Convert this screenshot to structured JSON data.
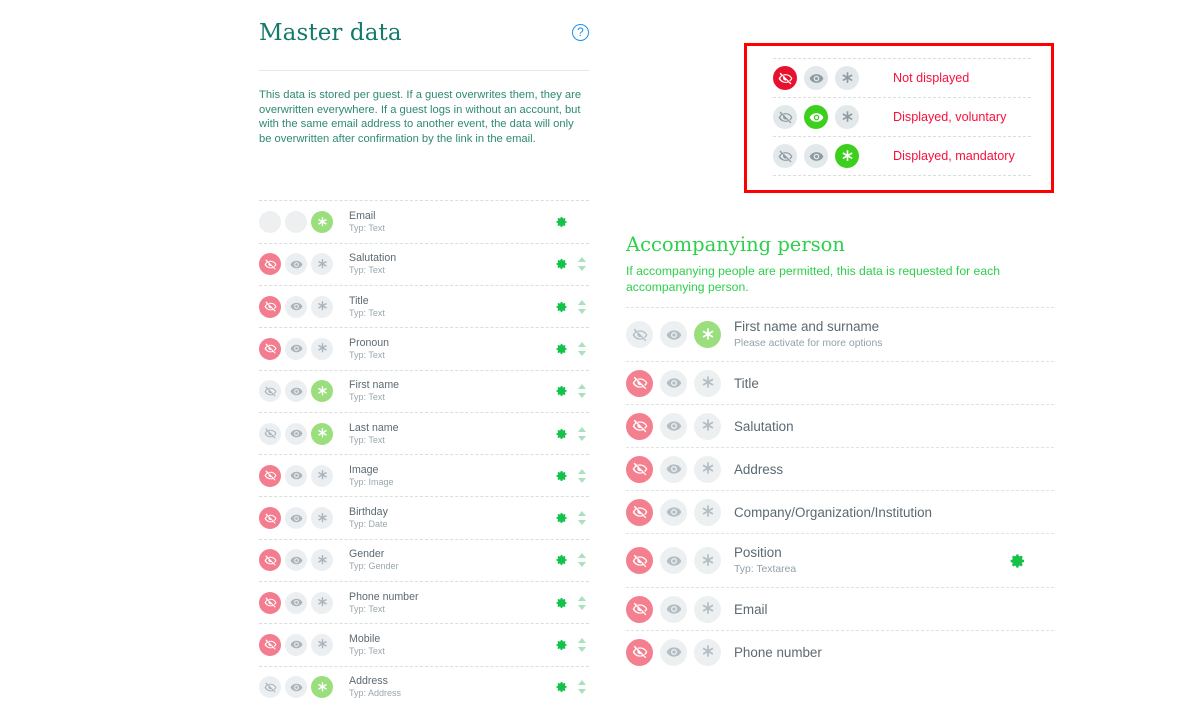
{
  "master": {
    "title": "Master data",
    "help_icon": "help-circle-icon",
    "intro": "This data is stored per guest. If a guest overwrites them, they are overwritten everywhere. If a guest logs in without an account, but with the same email address to another event, the data will only be overwritten after confirmation by the link in the email.",
    "fields": [
      {
        "label": "Email",
        "type": "Typ: Text",
        "state": "star",
        "locked": true,
        "sortable": false
      },
      {
        "label": "Salutation",
        "type": "Typ: Text",
        "state": "hide",
        "locked": false,
        "sortable": true
      },
      {
        "label": "Title",
        "type": "Typ: Text",
        "state": "hide",
        "locked": false,
        "sortable": true
      },
      {
        "label": "Pronoun",
        "type": "Typ: Text",
        "state": "hide",
        "locked": false,
        "sortable": true
      },
      {
        "label": "First name",
        "type": "Typ: Text",
        "state": "star",
        "locked": false,
        "sortable": true
      },
      {
        "label": "Last name",
        "type": "Typ: Text",
        "state": "star",
        "locked": false,
        "sortable": true
      },
      {
        "label": "Image",
        "type": "Typ: Image",
        "state": "hide",
        "locked": false,
        "sortable": true
      },
      {
        "label": "Birthday",
        "type": "Typ: Date",
        "state": "hide",
        "locked": false,
        "sortable": true
      },
      {
        "label": "Gender",
        "type": "Typ: Gender",
        "state": "hide",
        "locked": false,
        "sortable": true
      },
      {
        "label": "Phone number",
        "type": "Typ: Text",
        "state": "hide",
        "locked": false,
        "sortable": true
      },
      {
        "label": "Mobile",
        "type": "Typ: Text",
        "state": "hide",
        "locked": false,
        "sortable": true
      },
      {
        "label": "Address",
        "type": "Typ: Address",
        "state": "star",
        "locked": false,
        "sortable": true
      }
    ]
  },
  "legend": {
    "border_color": "#ff0000",
    "text_color": "#fa0f3c",
    "active_hide_color": "#e8112d",
    "active_green_color": "#3ccf1d",
    "rows": [
      {
        "label": "Not displayed",
        "state": "hide"
      },
      {
        "label": "Displayed, voluntary",
        "state": "eye"
      },
      {
        "label": "Displayed, mandatory",
        "state": "star"
      }
    ]
  },
  "accompanying": {
    "title": "Accompanying person",
    "subtitle": "If accompanying people are permitted, this data is requested for each accompanying person.",
    "fields": [
      {
        "label": "First name and surname",
        "sub": "Please activate for more options",
        "state": "star",
        "gear": false
      },
      {
        "label": "Title",
        "sub": "",
        "state": "hide",
        "gear": false
      },
      {
        "label": "Salutation",
        "sub": "",
        "state": "hide",
        "gear": false
      },
      {
        "label": "Address",
        "sub": "",
        "state": "hide",
        "gear": false
      },
      {
        "label": "Company/Organization/Institution",
        "sub": "",
        "state": "hide",
        "gear": false
      },
      {
        "label": "Position",
        "sub": "Typ: Textarea",
        "state": "hide",
        "gear": true
      },
      {
        "label": "Email",
        "sub": "",
        "state": "hide",
        "gear": false
      },
      {
        "label": "Phone number",
        "sub": "",
        "state": "hide",
        "gear": false
      }
    ]
  },
  "icons": {
    "eye_slash": "eye-slash-icon",
    "eye": "eye-icon",
    "asterisk": "asterisk-icon",
    "gear": "gear-icon",
    "sort_up": "sort-up-icon",
    "sort_down": "sort-down-icon"
  }
}
